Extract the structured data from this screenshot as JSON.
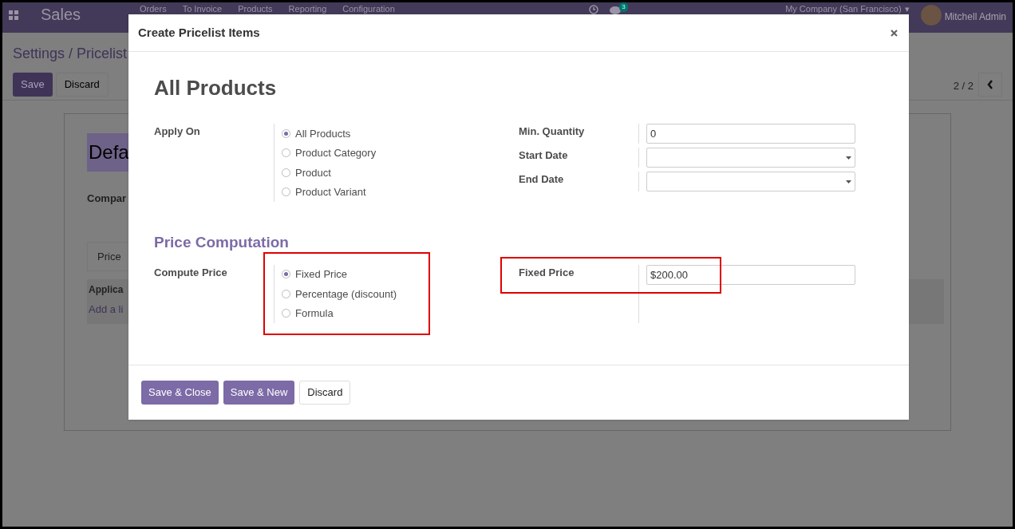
{
  "navbar": {
    "app_name": "Sales",
    "menu": [
      "Orders",
      "To Invoice",
      "Products",
      "Reporting",
      "Configuration"
    ],
    "message_count": "3",
    "company": "My Company (San Francisco)",
    "company_caret": "▾",
    "user": "Mitchell Admin"
  },
  "control_panel": {
    "breadcrumb": "Settings / Pricelist",
    "buttons": [
      "Save",
      "Discard"
    ],
    "pager": "2 / 2"
  },
  "sheet": {
    "title": "Defa",
    "company_label": "Compar",
    "tab": "Price",
    "section_label": "Applica",
    "add_line": "Add a li"
  },
  "dialog": {
    "title": "Create Pricelist Items",
    "heading": "All Products",
    "apply_on": {
      "label": "Apply On",
      "options": [
        {
          "label": "All Products",
          "selected": true
        },
        {
          "label": "Product Category",
          "selected": false
        },
        {
          "label": "Product",
          "selected": false
        },
        {
          "label": "Product Variant",
          "selected": false
        }
      ]
    },
    "fields": [
      {
        "label": "Min. Quantity",
        "value": "0",
        "kind": "text"
      },
      {
        "label": "Start Date",
        "kind": "date"
      },
      {
        "label": "End Date",
        "kind": "date"
      }
    ],
    "section_title": "Price Computation",
    "compute_price": {
      "label": "Compute Price",
      "highlighted": true,
      "options": [
        {
          "label": "Fixed Price",
          "selected": true
        },
        {
          "label": "Percentage (discount)",
          "selected": false
        },
        {
          "label": "Formula",
          "selected": false
        }
      ]
    },
    "fixed_price": {
      "label": "Fixed Price",
      "value": "$200.00",
      "highlighted": true
    },
    "buttons": [
      {
        "label": "Save & Close",
        "kind": "primary"
      },
      {
        "label": "Save & New",
        "kind": "primary"
      },
      {
        "label": "Discard",
        "kind": "secondary"
      }
    ]
  }
}
